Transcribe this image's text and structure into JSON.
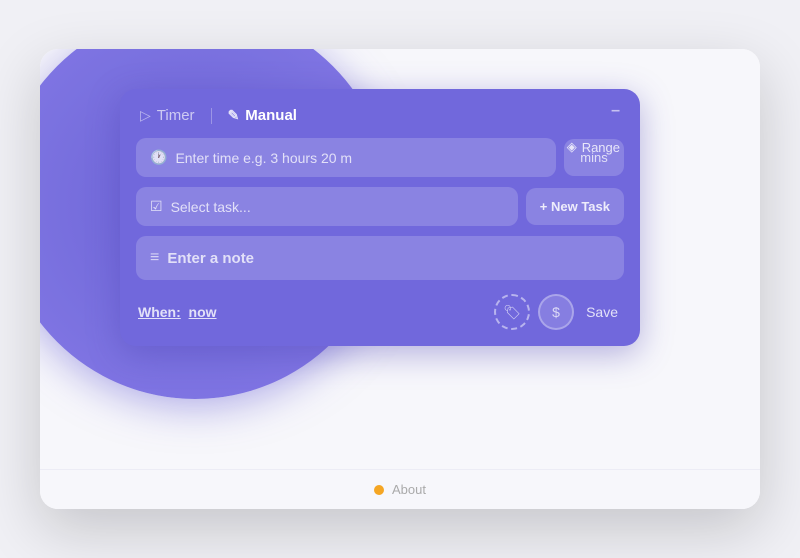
{
  "tabs": [
    {
      "id": "timer",
      "label": "Timer",
      "icon": "▷",
      "active": false
    },
    {
      "id": "manual",
      "label": "Manual",
      "icon": "✎",
      "active": true
    }
  ],
  "range_button": {
    "label": "Range",
    "icon": "◈"
  },
  "minimize_label": "–",
  "time_input": {
    "placeholder": "Enter time e.g. 3 hours 20 m",
    "mins_label": "mins"
  },
  "task_input": {
    "placeholder": "Select task..."
  },
  "new_task_button": "+ New Task",
  "note_input": {
    "placeholder": "Enter a note",
    "icon": "≡"
  },
  "when": {
    "label": "When:",
    "value": "now"
  },
  "save_button": "Save",
  "about_bar": {
    "dot_color": "#f5a623",
    "label": "About"
  }
}
